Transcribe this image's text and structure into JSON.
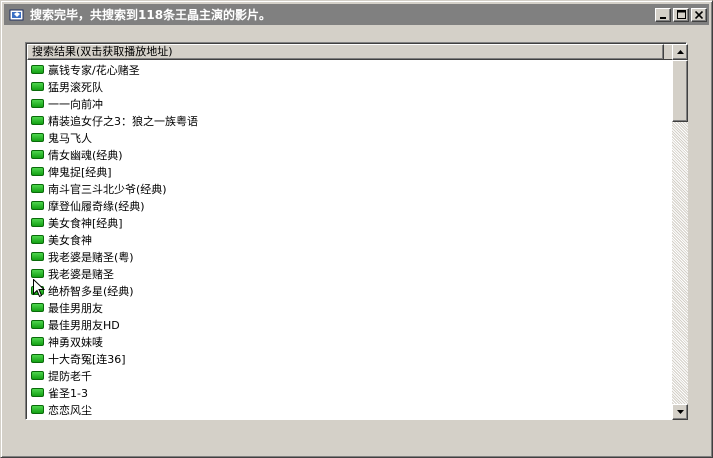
{
  "window": {
    "title": "搜索完毕，共搜索到118条王晶主演的影片。",
    "icon": "app-icon",
    "controls": {
      "minimize_icon": "minimize-icon",
      "maximize_icon": "maximize-icon",
      "close_icon": "close-icon"
    }
  },
  "results": {
    "header": "搜索结果(双击获取播放地址)",
    "status_icon": "green-led-icon",
    "status_color": "#22b422",
    "items": [
      "赢钱专家/花心赌圣",
      "猛男滚死队",
      "一一向前冲",
      "精装追女仔之3：狼之一族粤语",
      "鬼马飞人",
      "倩女幽魂(经典)",
      "俾鬼捉[经典]",
      "南斗官三斗北少爷(经典)",
      "摩登仙履奇缘(经典)",
      "美女食神[经典]",
      "美女食神",
      "我老婆是赌圣(粤)",
      "我老婆是赌圣",
      "绝桥智多星(经典)",
      "最佳男朋友",
      "最佳男朋友HD",
      "神勇双妹唛",
      "十大奇冤[连36]",
      "提防老千",
      "雀圣1-3",
      "恋恋风尘"
    ]
  },
  "scrollbar": {
    "position": 0.0,
    "visible_fraction": 0.18,
    "up_icon": "scroll-up-arrow-icon",
    "down_icon": "scroll-down-arrow-icon"
  },
  "cursor_icon": "mouse-pointer-icon"
}
